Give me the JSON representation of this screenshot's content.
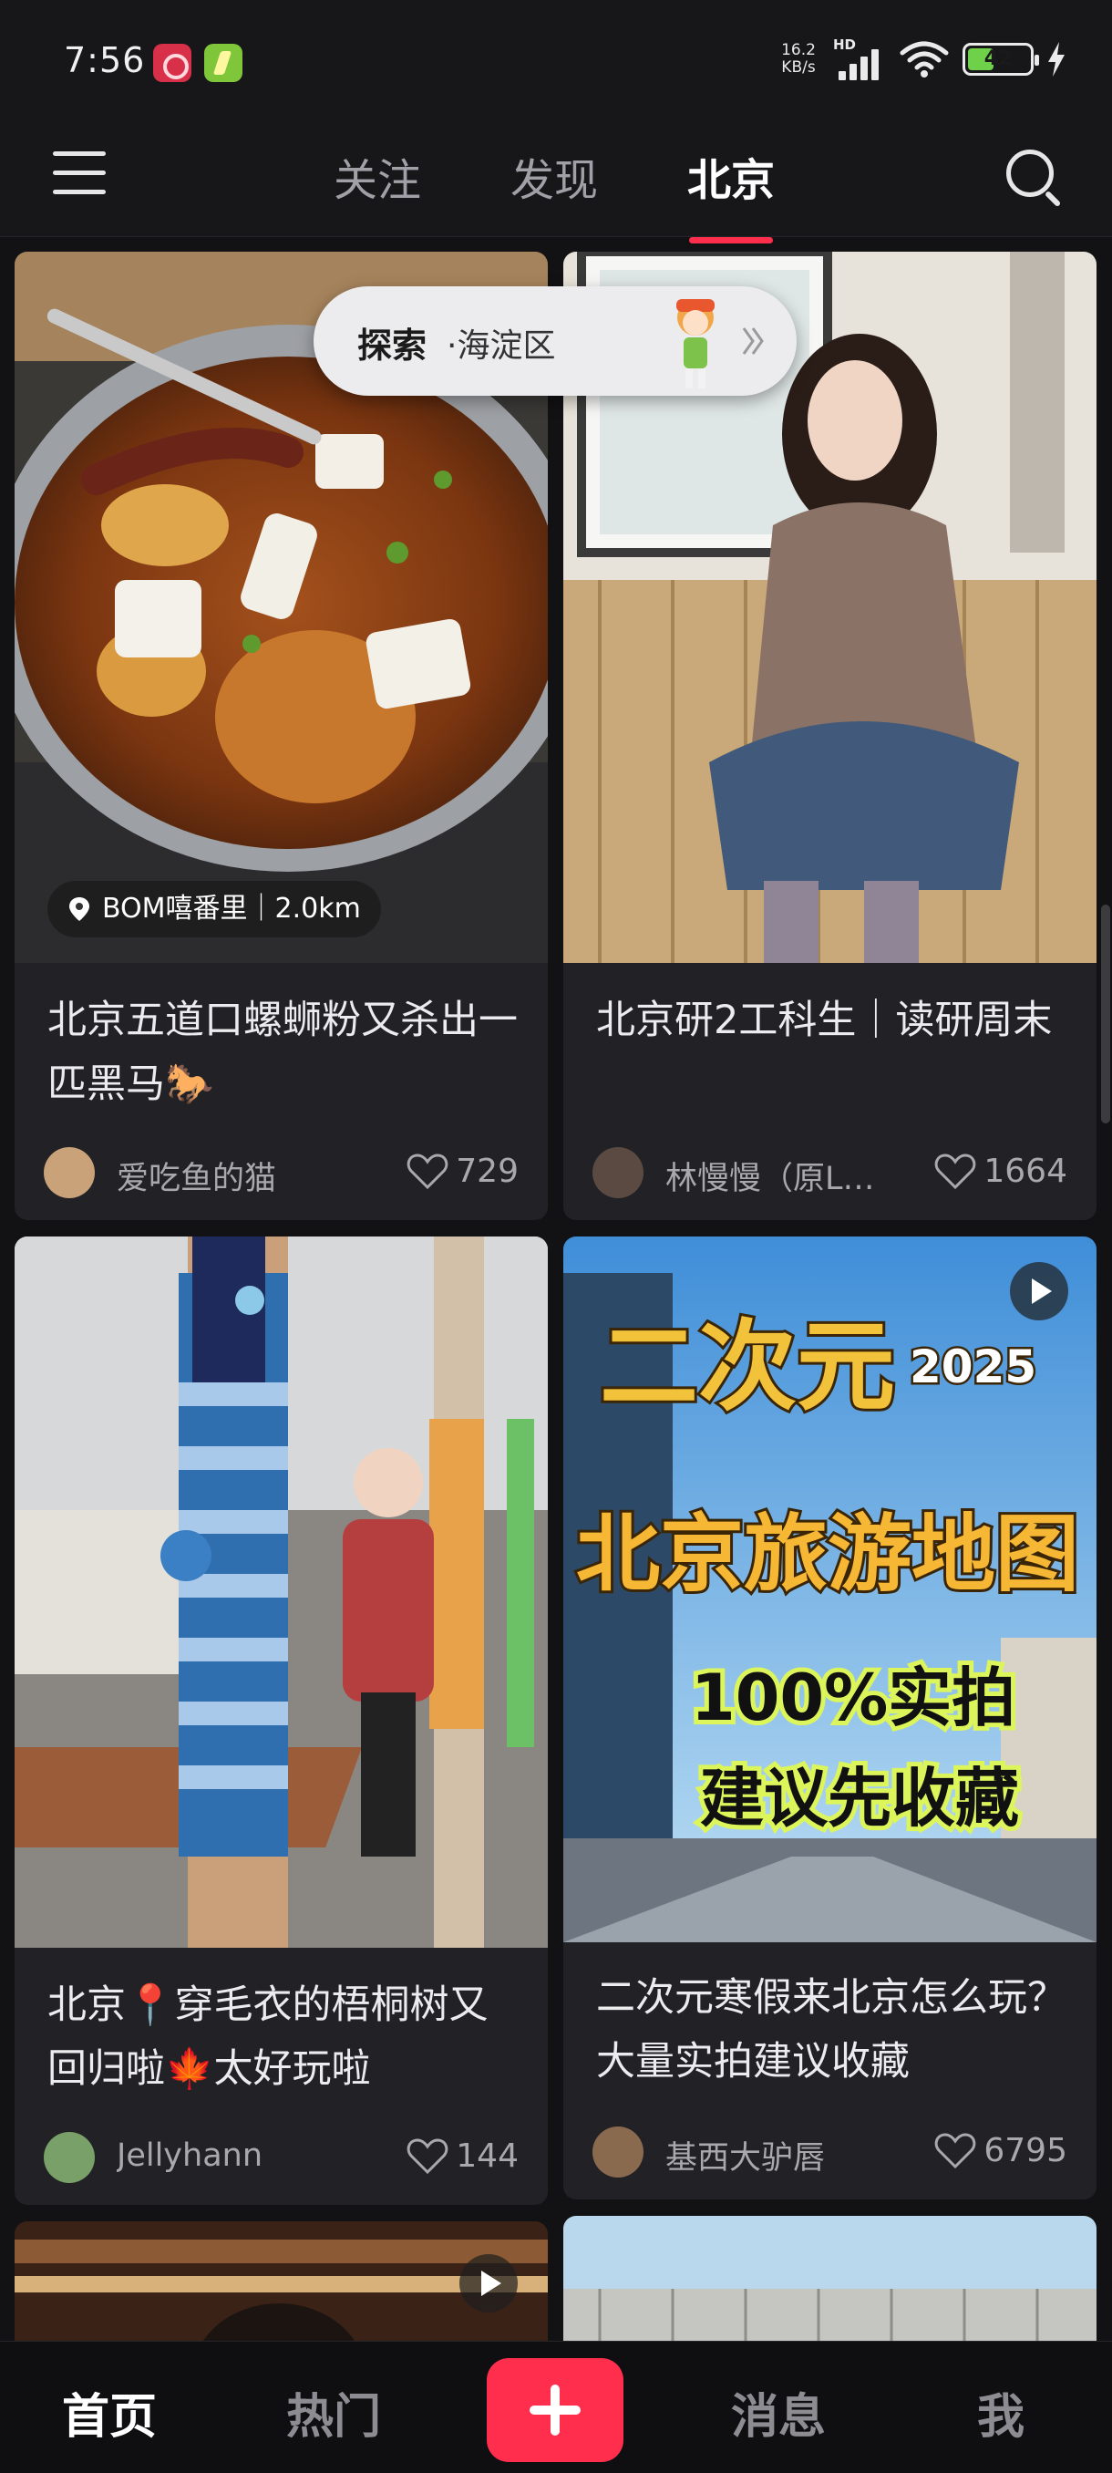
{
  "status_bar": {
    "time": "7:56",
    "net_speed_value": "16.2",
    "net_speed_unit": "KB/s",
    "network_tag": "HD",
    "battery_level": "42",
    "battery_fraction": 0.42,
    "icons": [
      "app-badge-icon",
      "charging-app-icon",
      "signal-icon",
      "wifi-icon",
      "battery-icon",
      "charging-bolt-icon"
    ]
  },
  "header": {
    "tabs": [
      {
        "label": "关注",
        "active": false
      },
      {
        "label": "发现",
        "active": false
      },
      {
        "label": "北京",
        "active": true
      }
    ],
    "accent_color": "#ff2e4d"
  },
  "explore_pill": {
    "label": "探索",
    "sub": "·海淀区"
  },
  "feed": {
    "cards": [
      {
        "title": "北京五道口螺蛳粉又杀出一匹黑马🐎",
        "location": "BOM嘻番里｜2.0km",
        "author": "爱吃鱼的猫",
        "likes": "729",
        "has_video": false
      },
      {
        "title": "北京研2工科生｜读研周末",
        "author": "林慢慢（原L…",
        "likes": "1664",
        "has_video": false
      },
      {
        "title": "北京📍穿毛衣的梧桐树又回归啦🍁太好玩啦",
        "author": "Jellyhann",
        "likes": "144",
        "has_video": false
      },
      {
        "title": "二次元寒假来北京怎么玩？大量实拍建议收藏",
        "author": "基西大驴唇",
        "likes": "6795",
        "has_video": true,
        "cover_text": {
          "line1": "二次元",
          "year": "2025",
          "line2": "北京旅游地图",
          "line3": "100%实拍",
          "line4": "建议先收藏"
        }
      }
    ]
  },
  "bottom_nav": {
    "items": [
      {
        "label": "首页",
        "active": true
      },
      {
        "label": "热门",
        "active": false
      },
      {
        "label": "消息",
        "active": false
      },
      {
        "label": "我",
        "active": false
      }
    ],
    "add_icon": "plus-icon"
  }
}
